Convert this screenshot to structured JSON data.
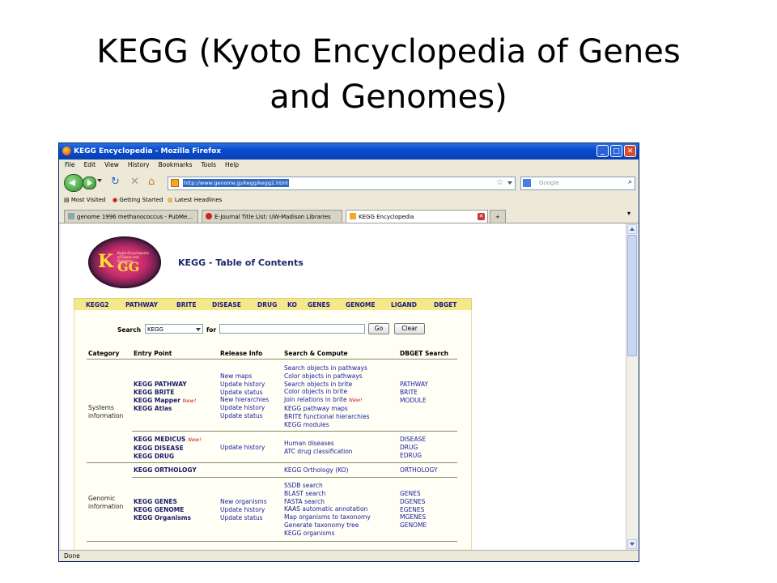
{
  "slide": {
    "title_line1": "KEGG (Kyoto Encyclopedia of Genes",
    "title_line2": "and Genomes)"
  },
  "browser": {
    "window_title": "KEGG Encyclopedia - Mozilla Firefox",
    "menu": [
      "File",
      "Edit",
      "View",
      "History",
      "Bookmarks",
      "Tools",
      "Help"
    ],
    "url": "http://www.genome.jp/kegg/kegg2.html",
    "search_placeholder": "Google",
    "bookmarks": [
      "Most Visited",
      "Getting Started",
      "Latest Headlines"
    ],
    "tabs": [
      "genome 1996 methanococcus - PubMe...",
      "E-Journal Title List: UW-Madison Libraries",
      "KEGG Encyclopedia"
    ],
    "status": "Done"
  },
  "page": {
    "logo_text": "KEGG",
    "logo_subtitle": "Kyoto Encyclopedia of Genes and Genomes",
    "heading": "KEGG - Table of Contents",
    "nav": [
      "KEGG2",
      "PATHWAY",
      "BRITE",
      "DISEASE",
      "DRUG",
      "KO",
      "GENES",
      "GENOME",
      "LIGAND",
      "DBGET"
    ],
    "search": {
      "label": "Search",
      "db": "KEGG",
      "for": "for",
      "go": "Go",
      "clear": "Clear"
    },
    "table": {
      "headers": [
        "Category",
        "Entry Point",
        "Release Info",
        "Search & Compute",
        "DBGET Search"
      ],
      "systems": {
        "category": [
          "Systems",
          "information"
        ],
        "entry": [
          "KEGG PATHWAY",
          "KEGG BRITE",
          "KEGG Mapper",
          "KEGG Atlas"
        ],
        "new_label": "New!",
        "release": [
          "New maps",
          "Update history",
          "Update status",
          "New hierarchies",
          "Update history",
          "Update status"
        ],
        "search": [
          "Search objects in pathways",
          "Color objects in pathways",
          "Search objects in brite",
          "Color objects in brite",
          "Join relations in brite",
          "KEGG pathway maps",
          "BRITE functional hierarchies",
          "KEGG modules"
        ],
        "dbget": [
          "PATHWAY",
          "BRITE",
          "MODULE"
        ]
      },
      "medicus": {
        "entry": [
          "KEGG MEDICUS",
          "KEGG DISEASE",
          "KEGG DRUG"
        ],
        "release": [
          "Update history"
        ],
        "search": [
          "Human diseases",
          "ATC drug classification"
        ],
        "dbget": [
          "DISEASE",
          "DRUG",
          "EDRUG"
        ]
      },
      "orthology": {
        "entry": "KEGG ORTHOLOGY",
        "search": "KEGG Orthology (KO)",
        "dbget": "ORTHOLOGY"
      },
      "genomic": {
        "category": [
          "Genomic",
          "information"
        ],
        "entry": [
          "KEGG GENES",
          "KEGG GENOME",
          "KEGG Organisms"
        ],
        "release": [
          "New organisms",
          "Update history",
          "Update status"
        ],
        "search": [
          "SSDB search",
          "BLAST search",
          "FASTA search",
          "KAAS automatic annotation",
          "Map organisms to taxonomy",
          "Generate taxonomy tree",
          "KEGG organisms"
        ],
        "dbget": [
          "GENES",
          "DGENES",
          "EGENES",
          "MGENES",
          "GENOME"
        ]
      }
    }
  }
}
